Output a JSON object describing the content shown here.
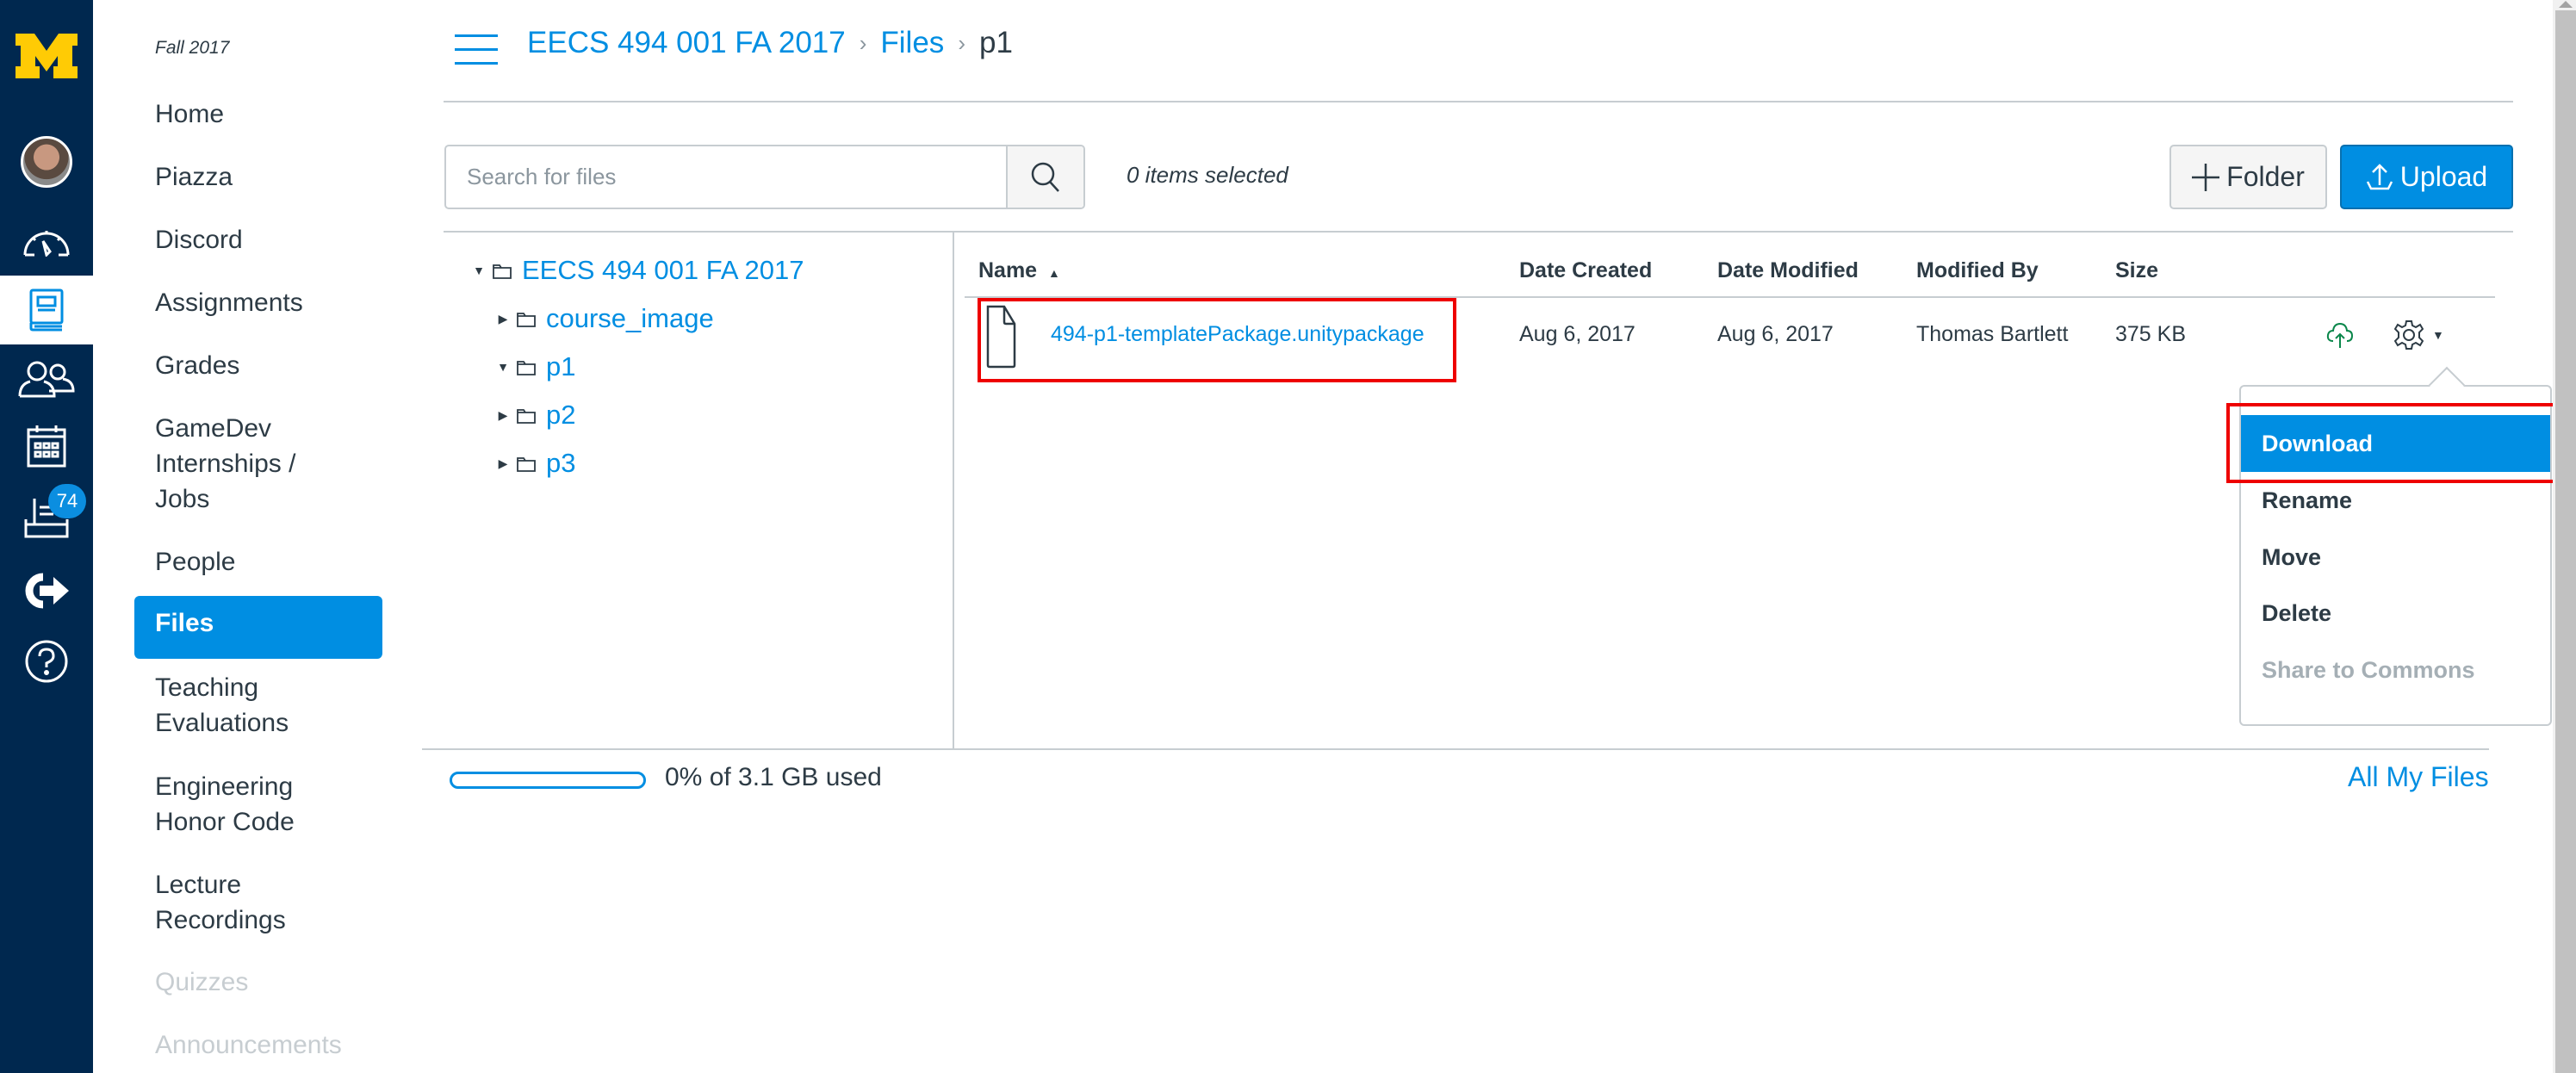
{
  "global_nav": {
    "items": [
      {
        "name": "logo",
        "icon": "university-m-logo"
      },
      {
        "name": "account",
        "icon": "avatar"
      },
      {
        "name": "dashboard",
        "icon": "dashboard-icon"
      },
      {
        "name": "courses",
        "icon": "courses-book-icon",
        "active": true
      },
      {
        "name": "groups",
        "icon": "groups-icon"
      },
      {
        "name": "calendar",
        "icon": "calendar-icon"
      },
      {
        "name": "inbox",
        "icon": "inbox-icon",
        "badge": "74"
      },
      {
        "name": "commons",
        "icon": "commons-icon"
      },
      {
        "name": "help",
        "icon": "help-icon"
      }
    ],
    "inbox_badge": "74"
  },
  "course_nav": {
    "term": "Fall 2017",
    "items": [
      {
        "label": "Home"
      },
      {
        "label": "Piazza"
      },
      {
        "label": "Discord"
      },
      {
        "label": "Assignments"
      },
      {
        "label": "Grades"
      },
      {
        "label": "GameDev Internships / Jobs",
        "lines": [
          "GameDev",
          "Internships /",
          "Jobs"
        ]
      },
      {
        "label": "People"
      },
      {
        "label": "Files",
        "active": true
      },
      {
        "label": "Teaching Evaluations",
        "lines": [
          "Teaching",
          "Evaluations"
        ]
      },
      {
        "label": "Engineering Honor Code",
        "lines": [
          "Engineering",
          "Honor Code"
        ]
      },
      {
        "label": "Lecture Recordings",
        "lines": [
          "Lecture",
          "Recordings"
        ]
      },
      {
        "label": "Quizzes",
        "disabled": true
      },
      {
        "label": "Announcements",
        "disabled": true
      }
    ]
  },
  "breadcrumb": {
    "items": [
      "EECS 494 001 FA 2017",
      "Files",
      "p1"
    ],
    "separator": "›"
  },
  "toolbar": {
    "search_placeholder": "Search for files",
    "search_value": "",
    "selection_status": "0 items selected",
    "folder_label": "Folder",
    "upload_label": "Upload"
  },
  "folder_tree": {
    "root": {
      "label": "EECS 494 001 FA 2017",
      "expanded": true
    },
    "children": [
      {
        "label": "course_image",
        "expanded": false
      },
      {
        "label": "p1",
        "expanded": true
      },
      {
        "label": "p2",
        "expanded": false
      },
      {
        "label": "p3",
        "expanded": false
      }
    ]
  },
  "file_table": {
    "columns": [
      "Name",
      "Date Created",
      "Date Modified",
      "Modified By",
      "Size"
    ],
    "sort_column": "Name",
    "sort_direction": "ascending",
    "rows": [
      {
        "name": "494-p1-templatePackage.unitypackage",
        "date_created": "Aug 6, 2017",
        "date_modified": "Aug 6, 2017",
        "modified_by": "Thomas Bartlett",
        "size": "375 KB",
        "published": true
      }
    ]
  },
  "context_menu": {
    "items": [
      {
        "label": "Download",
        "highlighted": true
      },
      {
        "label": "Rename"
      },
      {
        "label": "Move"
      },
      {
        "label": "Delete"
      },
      {
        "label": "Share to Commons",
        "disabled": true
      }
    ]
  },
  "footer": {
    "quota_used_percent": 0,
    "quota_text": "0% of 3.1 GB used",
    "all_files_link": "All My Files"
  },
  "colors": {
    "brand_nav": "#00284f",
    "accent": "#008ee2",
    "logo_yellow": "#ffcb05",
    "annotation_red": "#ee0000",
    "published_green": "#0b874b"
  }
}
